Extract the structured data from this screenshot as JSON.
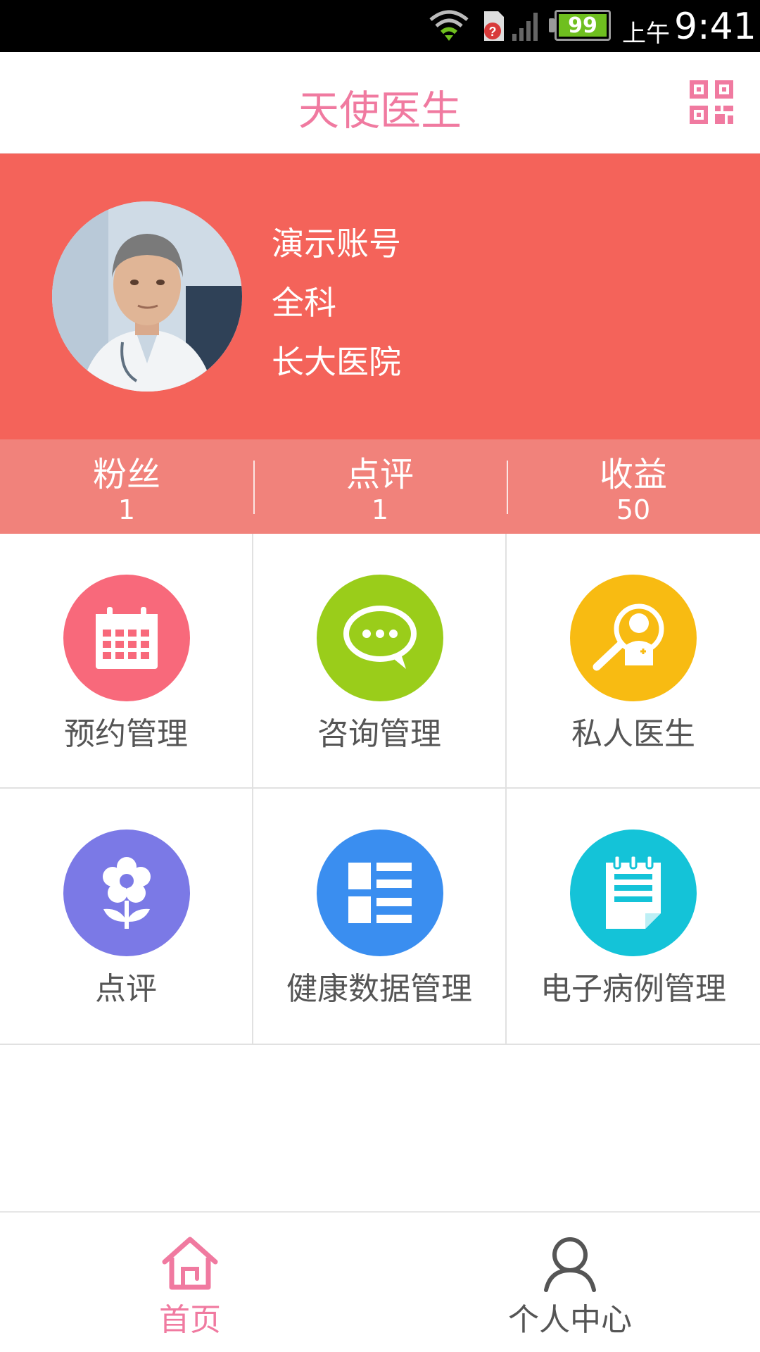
{
  "status_bar": {
    "battery": "99",
    "time_prefix": "上午",
    "time": "9:41",
    "icons": [
      "wifi-icon",
      "sim-alert-icon",
      "signal-icon",
      "battery-icon"
    ]
  },
  "header": {
    "title": "天使医生",
    "qr_icon": "qr-code-icon"
  },
  "profile": {
    "name": "演示账号",
    "department": "全科",
    "hospital": "长大医院"
  },
  "stats": [
    {
      "label": "粉丝",
      "value": "1"
    },
    {
      "label": "点评",
      "value": "1"
    },
    {
      "label": "收益",
      "value": "50"
    }
  ],
  "grid": [
    {
      "label": "预约管理",
      "icon": "calendar-icon",
      "color": "#f8697b"
    },
    {
      "label": "咨询管理",
      "icon": "chat-bubble-icon",
      "color": "#9acd1a"
    },
    {
      "label": "私人医生",
      "icon": "doctor-search-icon",
      "color": "#f8bb12"
    },
    {
      "label": "点评",
      "icon": "flower-icon",
      "color": "#7b79e6"
    },
    {
      "label": "健康数据管理",
      "icon": "list-grid-icon",
      "color": "#3a8ef0"
    },
    {
      "label": "电子病例管理",
      "icon": "notepad-icon",
      "color": "#14c3d8"
    }
  ],
  "tabs": [
    {
      "label": "首页",
      "icon": "home-icon",
      "active": true,
      "color": "#f07aa0"
    },
    {
      "label": "个人中心",
      "icon": "person-icon",
      "active": false,
      "color": "#555555"
    }
  ],
  "colors": {
    "brand": "#f07aa0",
    "profile_bg": "#f4635a",
    "stats_bg": "#f1827b"
  }
}
